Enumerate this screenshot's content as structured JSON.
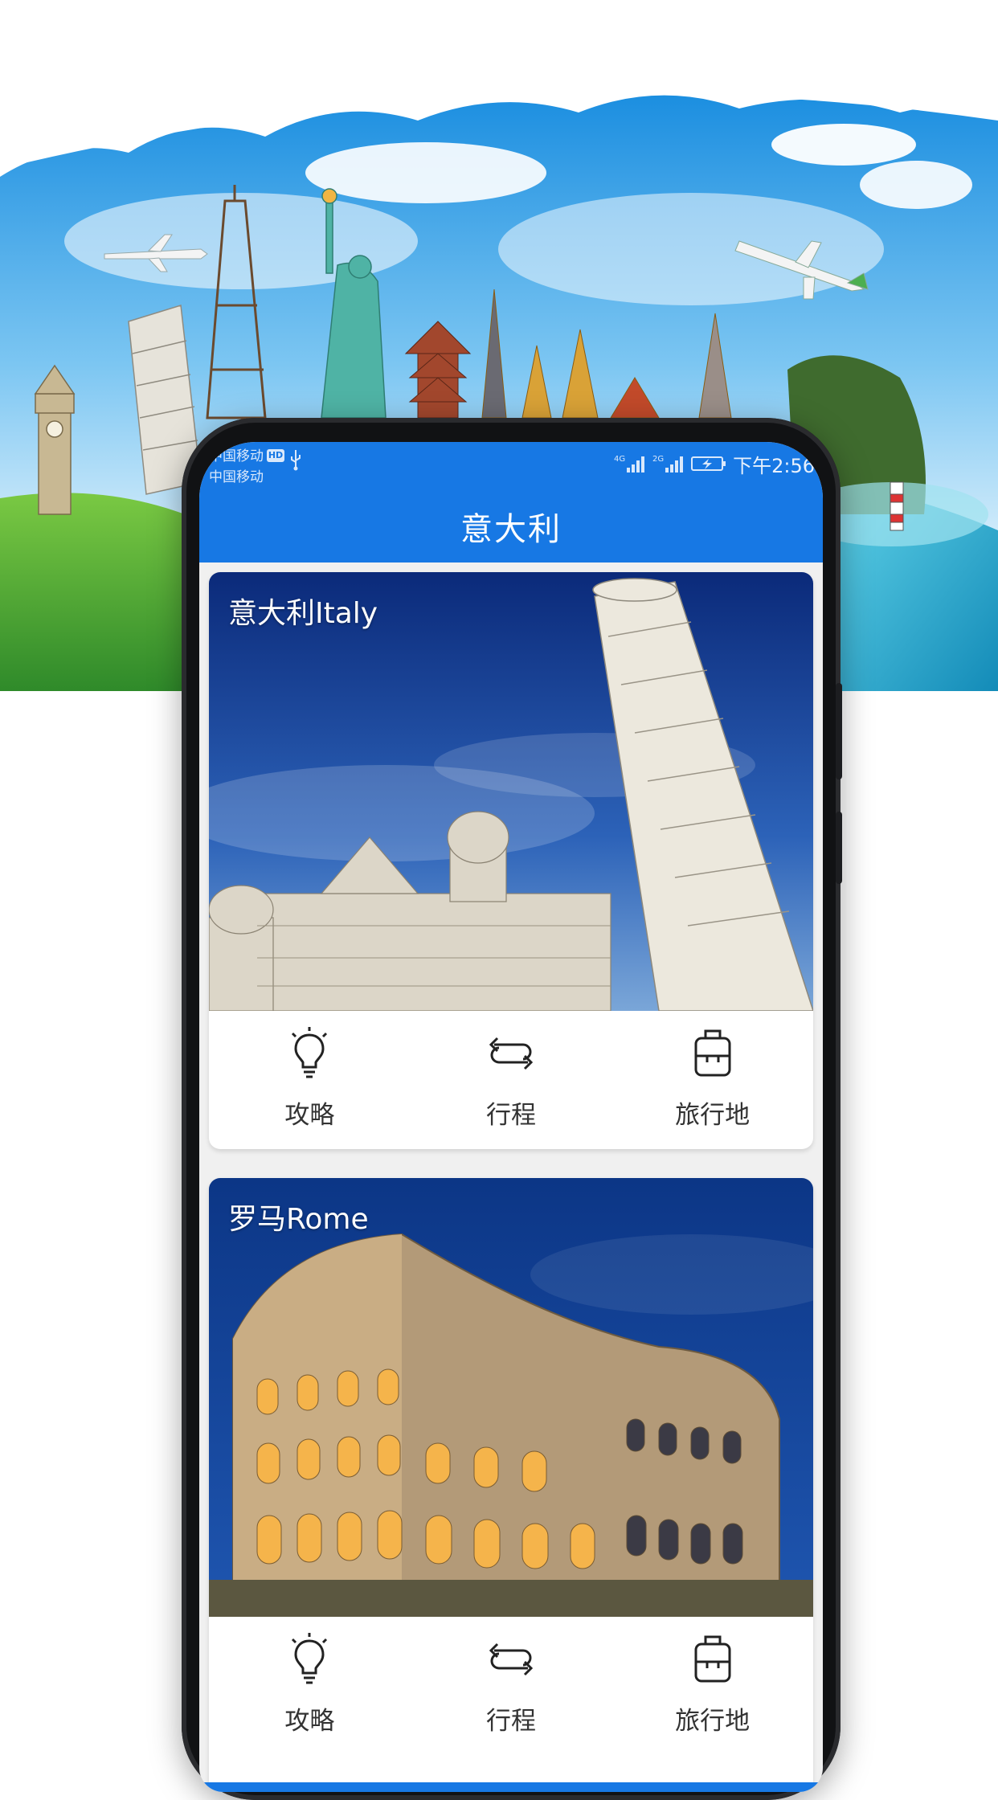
{
  "status_bar": {
    "carrier_1": "中国移动",
    "carrier_2": "中国移动",
    "hd_badge": "HD",
    "network_1": "4G",
    "network_2": "2G",
    "time": "下午2:56"
  },
  "header": {
    "title": "意大利"
  },
  "cards": [
    {
      "label": "意大利Italy",
      "actions": [
        {
          "label": "攻略",
          "icon": "lightbulb-icon"
        },
        {
          "label": "行程",
          "icon": "swap-arrows-icon"
        },
        {
          "label": "旅行地",
          "icon": "suitcase-icon"
        }
      ]
    },
    {
      "label": "罗马Rome",
      "actions": [
        {
          "label": "攻略",
          "icon": "lightbulb-icon"
        },
        {
          "label": "行程",
          "icon": "swap-arrows-icon"
        },
        {
          "label": "旅行地",
          "icon": "suitcase-icon"
        }
      ]
    }
  ],
  "colors": {
    "primary": "#1778e4",
    "screen_bg": "#f0f0f0",
    "card_bg": "#ffffff",
    "text_dark": "#333333",
    "phone_frame": "#111214"
  }
}
